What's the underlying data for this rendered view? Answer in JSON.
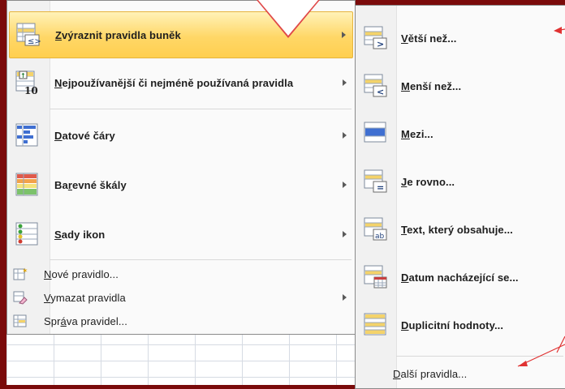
{
  "main_menu": {
    "items": [
      {
        "label_pre": "",
        "label_u": "Z",
        "label_post": "výraznit pravidla buněk",
        "icon": "highlight-cells-rules-icon",
        "highlighted": true,
        "submenu": true
      },
      {
        "label_pre": "",
        "label_u": "N",
        "label_post": "ejpoužívanější či nejméně používaná pravidla",
        "icon": "top-bottom-rules-icon",
        "submenu": true
      },
      {
        "label_pre": "",
        "label_u": "D",
        "label_post": "atové čáry",
        "icon": "data-bars-icon",
        "submenu": true
      },
      {
        "label_pre": "Ba",
        "label_u": "r",
        "label_post": "evné škály",
        "icon": "color-scales-icon",
        "submenu": true
      },
      {
        "label_pre": "",
        "label_u": "S",
        "label_post": "ady ikon",
        "icon": "icon-sets-icon",
        "submenu": true
      }
    ],
    "small_items": [
      {
        "label_pre": "",
        "label_u": "N",
        "label_post": "ové pravidlo...",
        "icon": "new-rule-icon"
      },
      {
        "label_pre": "",
        "label_u": "V",
        "label_post": "ymazat pravidla",
        "icon": "clear-rules-icon",
        "submenu": true
      },
      {
        "label_pre": "Spr",
        "label_u": "á",
        "label_post": "va pravidel...",
        "icon": "manage-rules-icon"
      }
    ]
  },
  "submenu": {
    "items": [
      {
        "label_pre": "",
        "label_u": "V",
        "label_post": "ětší než...",
        "icon": "greater-than-icon",
        "glyph": ">"
      },
      {
        "label_pre": "",
        "label_u": "M",
        "label_post": "enší než...",
        "icon": "less-than-icon",
        "glyph": "<"
      },
      {
        "label_pre": "",
        "label_u": "M",
        "label_post": "ezi...",
        "icon": "between-icon",
        "glyph": ""
      },
      {
        "label_pre": "",
        "label_u": "J",
        "label_post": "e rovno...",
        "icon": "equal-to-icon",
        "glyph": "="
      },
      {
        "label_pre": "",
        "label_u": "T",
        "label_post": "ext, který obsahuje...",
        "icon": "text-contains-icon",
        "glyph": "ab"
      },
      {
        "label_pre": "",
        "label_u": "D",
        "label_post": "atum nacházející se...",
        "icon": "date-occurring-icon",
        "glyph": ""
      },
      {
        "label_pre": "",
        "label_u": "D",
        "label_post": "uplicitní hodnoty...",
        "icon": "duplicate-values-icon",
        "glyph": ""
      }
    ],
    "more_rules": {
      "label_pre": "",
      "label_u": "D",
      "label_post": "alší pravidla..."
    }
  },
  "colors": {
    "background": "#7a0a0a",
    "highlight": "#ffd767",
    "annotation_red": "#e03232"
  }
}
